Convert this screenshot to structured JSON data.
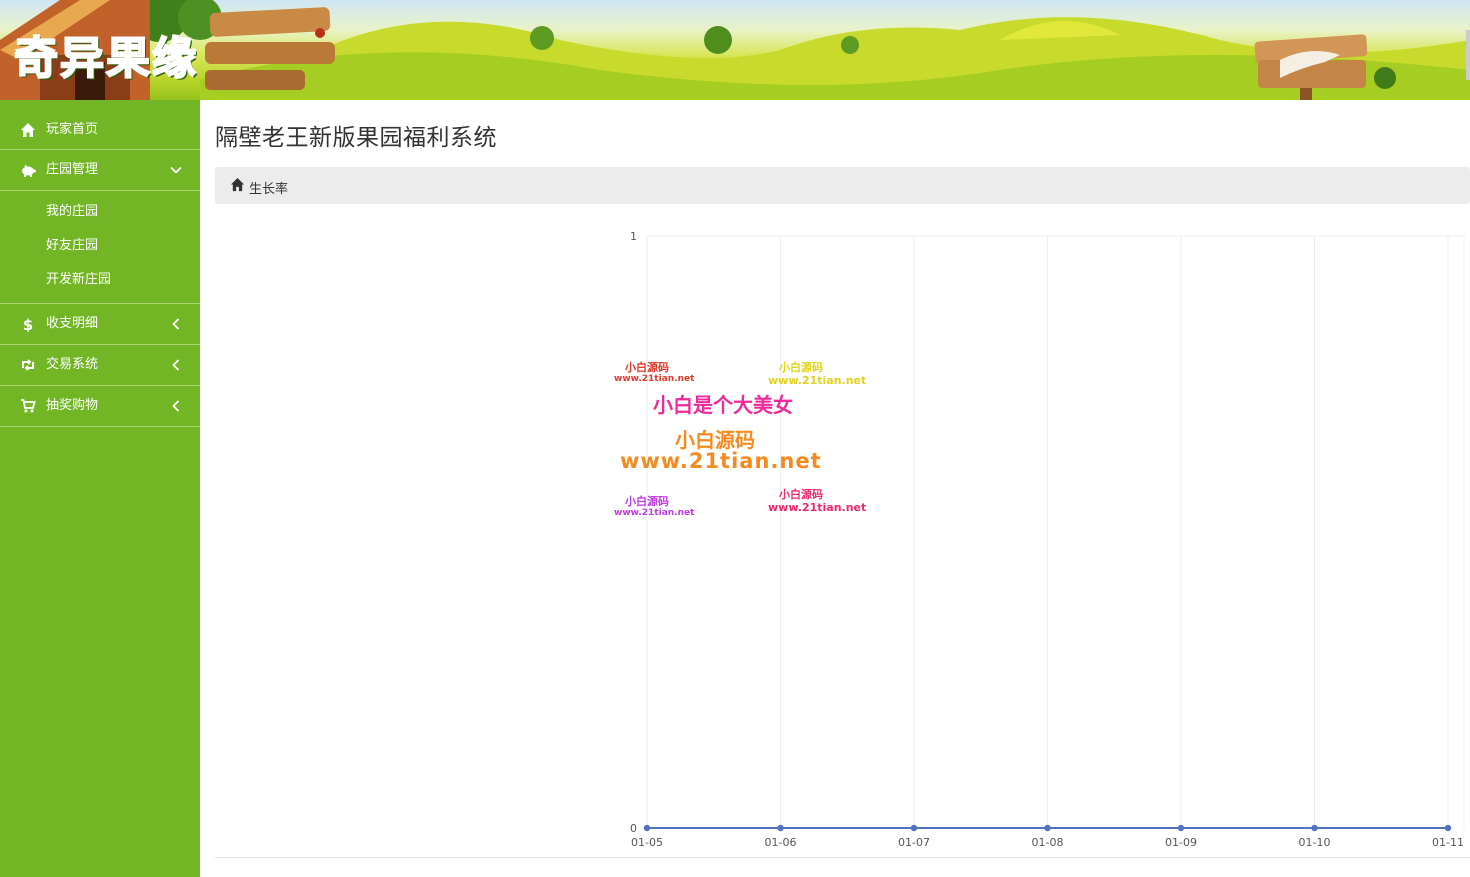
{
  "app": {
    "logo_text": "奇异果缘",
    "title": "隔壁老王新版果园福利系统"
  },
  "sidebar": {
    "items": [
      {
        "label": "玩家首页",
        "icon": "home-icon"
      },
      {
        "label": "庄园管理",
        "icon": "piggy-bank-icon",
        "expanded": true,
        "children": [
          {
            "label": "我的庄园"
          },
          {
            "label": "好友庄园"
          },
          {
            "label": "开发新庄园"
          }
        ]
      },
      {
        "label": "收支明细",
        "icon": "dollar-icon"
      },
      {
        "label": "交易系统",
        "icon": "retweet-icon"
      },
      {
        "label": "抽奖购物",
        "icon": "cart-icon"
      }
    ]
  },
  "breadcrumb": {
    "icon": "home-icon",
    "label": "生长率"
  },
  "watermark": {
    "site_name": "小白源码",
    "url": "www.21tian.net",
    "slogan": "小白是个大美女"
  },
  "chart_data": {
    "type": "line",
    "categories": [
      "01-05",
      "01-06",
      "01-07",
      "01-08",
      "01-09",
      "01-10",
      "01-11"
    ],
    "series": [
      {
        "values": [
          0,
          0,
          0,
          0,
          0,
          0,
          0
        ]
      }
    ],
    "ylim": [
      0,
      1
    ],
    "y_ticks": [
      "0",
      "1"
    ],
    "grid": true,
    "color": "#4f73c2"
  },
  "colors": {
    "sidebar_bg": "#72b626",
    "breadcrumb_bg": "#ececec",
    "line": "#4f73c2"
  }
}
